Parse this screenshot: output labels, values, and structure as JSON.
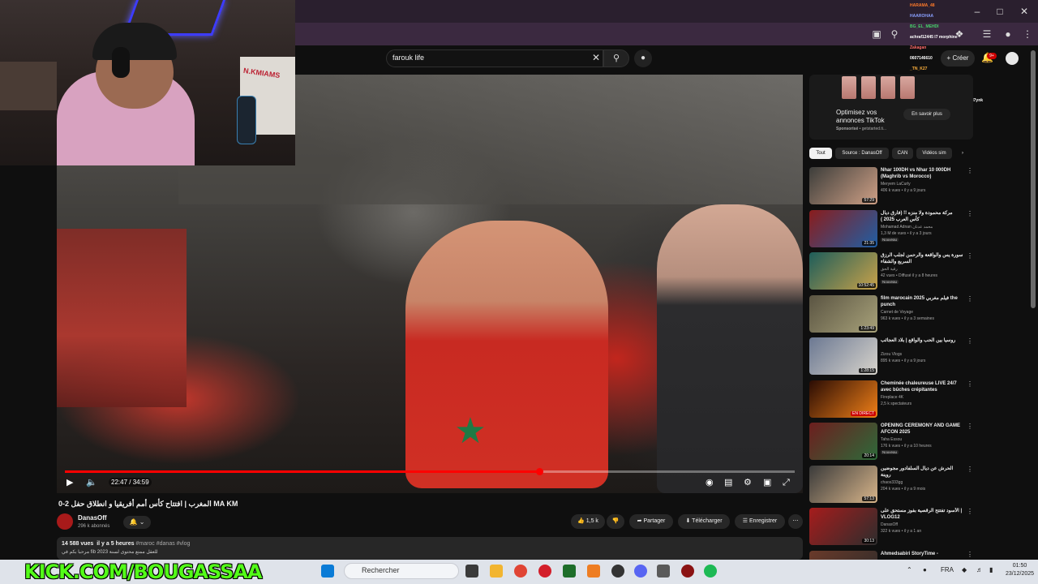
{
  "search": {
    "query": "farouk life"
  },
  "header": {
    "create_label": "Créer",
    "notif_count": "9+"
  },
  "video": {
    "current_time": "22:47",
    "duration": "34:59",
    "time_display": "22:47 / 34:59",
    "progress": 0.651
  },
  "webcam": {
    "poster_text": "N.KMIAMS"
  },
  "chat": [
    {
      "text": "HARAMA_48",
      "color": "#ff7a2a"
    },
    {
      "text": "HAAROHAA",
      "color": "#8aa0ff"
    },
    {
      "text": "BG_EL_MEHDI",
      "color": "#46d36a"
    },
    {
      "text": "achraf12445 l7 morphine",
      "color": "#ffffff"
    },
    {
      "text": "Zakagan",
      "color": "#ff6a6a"
    },
    {
      "text": "0607146610",
      "color": "#ffffff"
    },
    {
      "text": "_TN_K27",
      "color": "#ffb13d"
    },
    {
      "text": "rhanas_a",
      "color": "#ff8dd0"
    },
    {
      "text": "Ilgym_exen",
      "color": "#7ec8ff"
    },
    {
      "text": "Doolfamingo_07 ckata k khesha l7ynk",
      "color": "#ffffff"
    }
  ],
  "title": "المغرب | افتتاح كأس أمم أفريقيا و انطلاق حفل 2-0 MA KM",
  "channel": {
    "name": "DanasOff",
    "subs": "296 k abonnés"
  },
  "actions": {
    "likes": "1,5 k",
    "share": "Partager",
    "download": "Télécharger",
    "save": "Enregistrer"
  },
  "description": {
    "views": "14 588 vues",
    "age": "il y a 5 heures",
    "tags": "#maroc #danas #vlog",
    "line2": "مرحبا بكم في fib للعقل ممتع محتوى لسنة 2023"
  },
  "ad": {
    "title": "Optimisez vos annonces TikTok",
    "sponsored": "Sponsorisé",
    "domain": "getstarted.ti...",
    "button": "En savoir plus"
  },
  "chips": [
    "Tout",
    "Source : DanasOff",
    "CAN",
    "Vidéos sim"
  ],
  "recommendations": [
    {
      "title": "Nhar 100DH vs Nhar 10 000DH (Maghrib vs Morocco)",
      "channel": "Meryem LaCurly",
      "meta": "406 k vues • il y a 9 jours",
      "duration": "57:29",
      "badge": "",
      "c1": "#3c3d3a",
      "c2": "#cfa086"
    },
    {
      "title": "مركة محمودة ولا منزه !! (فارق ديال كأس العرب 2025 )",
      "channel": "Mohamad Adnan محمد عدنان",
      "meta": "1,3 M de vues • il y a 3 jours",
      "duration": "21:35",
      "badge": "Nouveau",
      "c1": "#8a1c1c",
      "c2": "#1f5fa5"
    },
    {
      "title": "سورة يس والواقعة والرحمن لجلب الرزق السريع والشفاء",
      "channel": "رقية الحق",
      "meta": "42 vues • Diffusé il y a 8 heures",
      "duration": "10:52:45",
      "badge": "Nouveau",
      "c1": "#1d5d5a",
      "c2": "#c9a24a"
    },
    {
      "title": "film marocain 2025 فيلم مغربي the punch",
      "channel": "Carnet de Voyage",
      "meta": "963 k vues • il y a 3 semaines",
      "duration": "1:23:49",
      "badge": "",
      "c1": "#5a5442",
      "c2": "#a8a27a"
    },
    {
      "title": "روسيا بين الحب والواقع | بلاد العجائب",
      "channel": "Zizou Vlogs",
      "meta": "895 k vues • il y a 9 jours",
      "duration": "1:28:15",
      "badge": "",
      "c1": "#6b7892",
      "c2": "#d8d4cc"
    },
    {
      "title": "Cheminée chaleureuse LIVE 24/7 avec bûches crépitantes",
      "channel": "Fireplace 4K",
      "meta": "2,5 k spectateurs",
      "duration": "EN DIRECT",
      "badge": "",
      "c1": "#2a0c04",
      "c2": "#f08018"
    },
    {
      "title": "OPENING CEREMONY AND GAME AFCON 2025",
      "channel": "Taha Essou",
      "meta": "176 k vues • il y a 10 heures",
      "duration": "20:14",
      "badge": "Nouveau",
      "c1": "#6d1e1e",
      "c2": "#2d6a3a"
    },
    {
      "title": "الحرش عن ديال السلفادور مجوضين روينة",
      "channel": "chaos333gg",
      "meta": "204 k vues • il y a 9 mois",
      "duration": "57:13",
      "badge": "",
      "c1": "#3a3a3a",
      "c2": "#d8b58a"
    },
    {
      "title": "الأسود تفتتح الرقصية بفوز مستحق على | VLOG12",
      "channel": "DanasOff",
      "meta": "322 k vues • il y a 1 an",
      "duration": "30:13",
      "badge": "",
      "c1": "#a61c1c",
      "c2": "#2d2d2d"
    },
    {
      "title": "Ahmedsabiri StoryTime -",
      "channel": "",
      "meta": "",
      "duration": "",
      "badge": "",
      "c1": "#6a3a2a",
      "c2": "#2a2a2a"
    }
  ],
  "taskbar": {
    "overlay_text": "KICK.COM/BOUGASSAA",
    "search_placeholder": "Rechercher",
    "lang": "FRA",
    "time": "01:50",
    "date": "23/12/2025"
  }
}
